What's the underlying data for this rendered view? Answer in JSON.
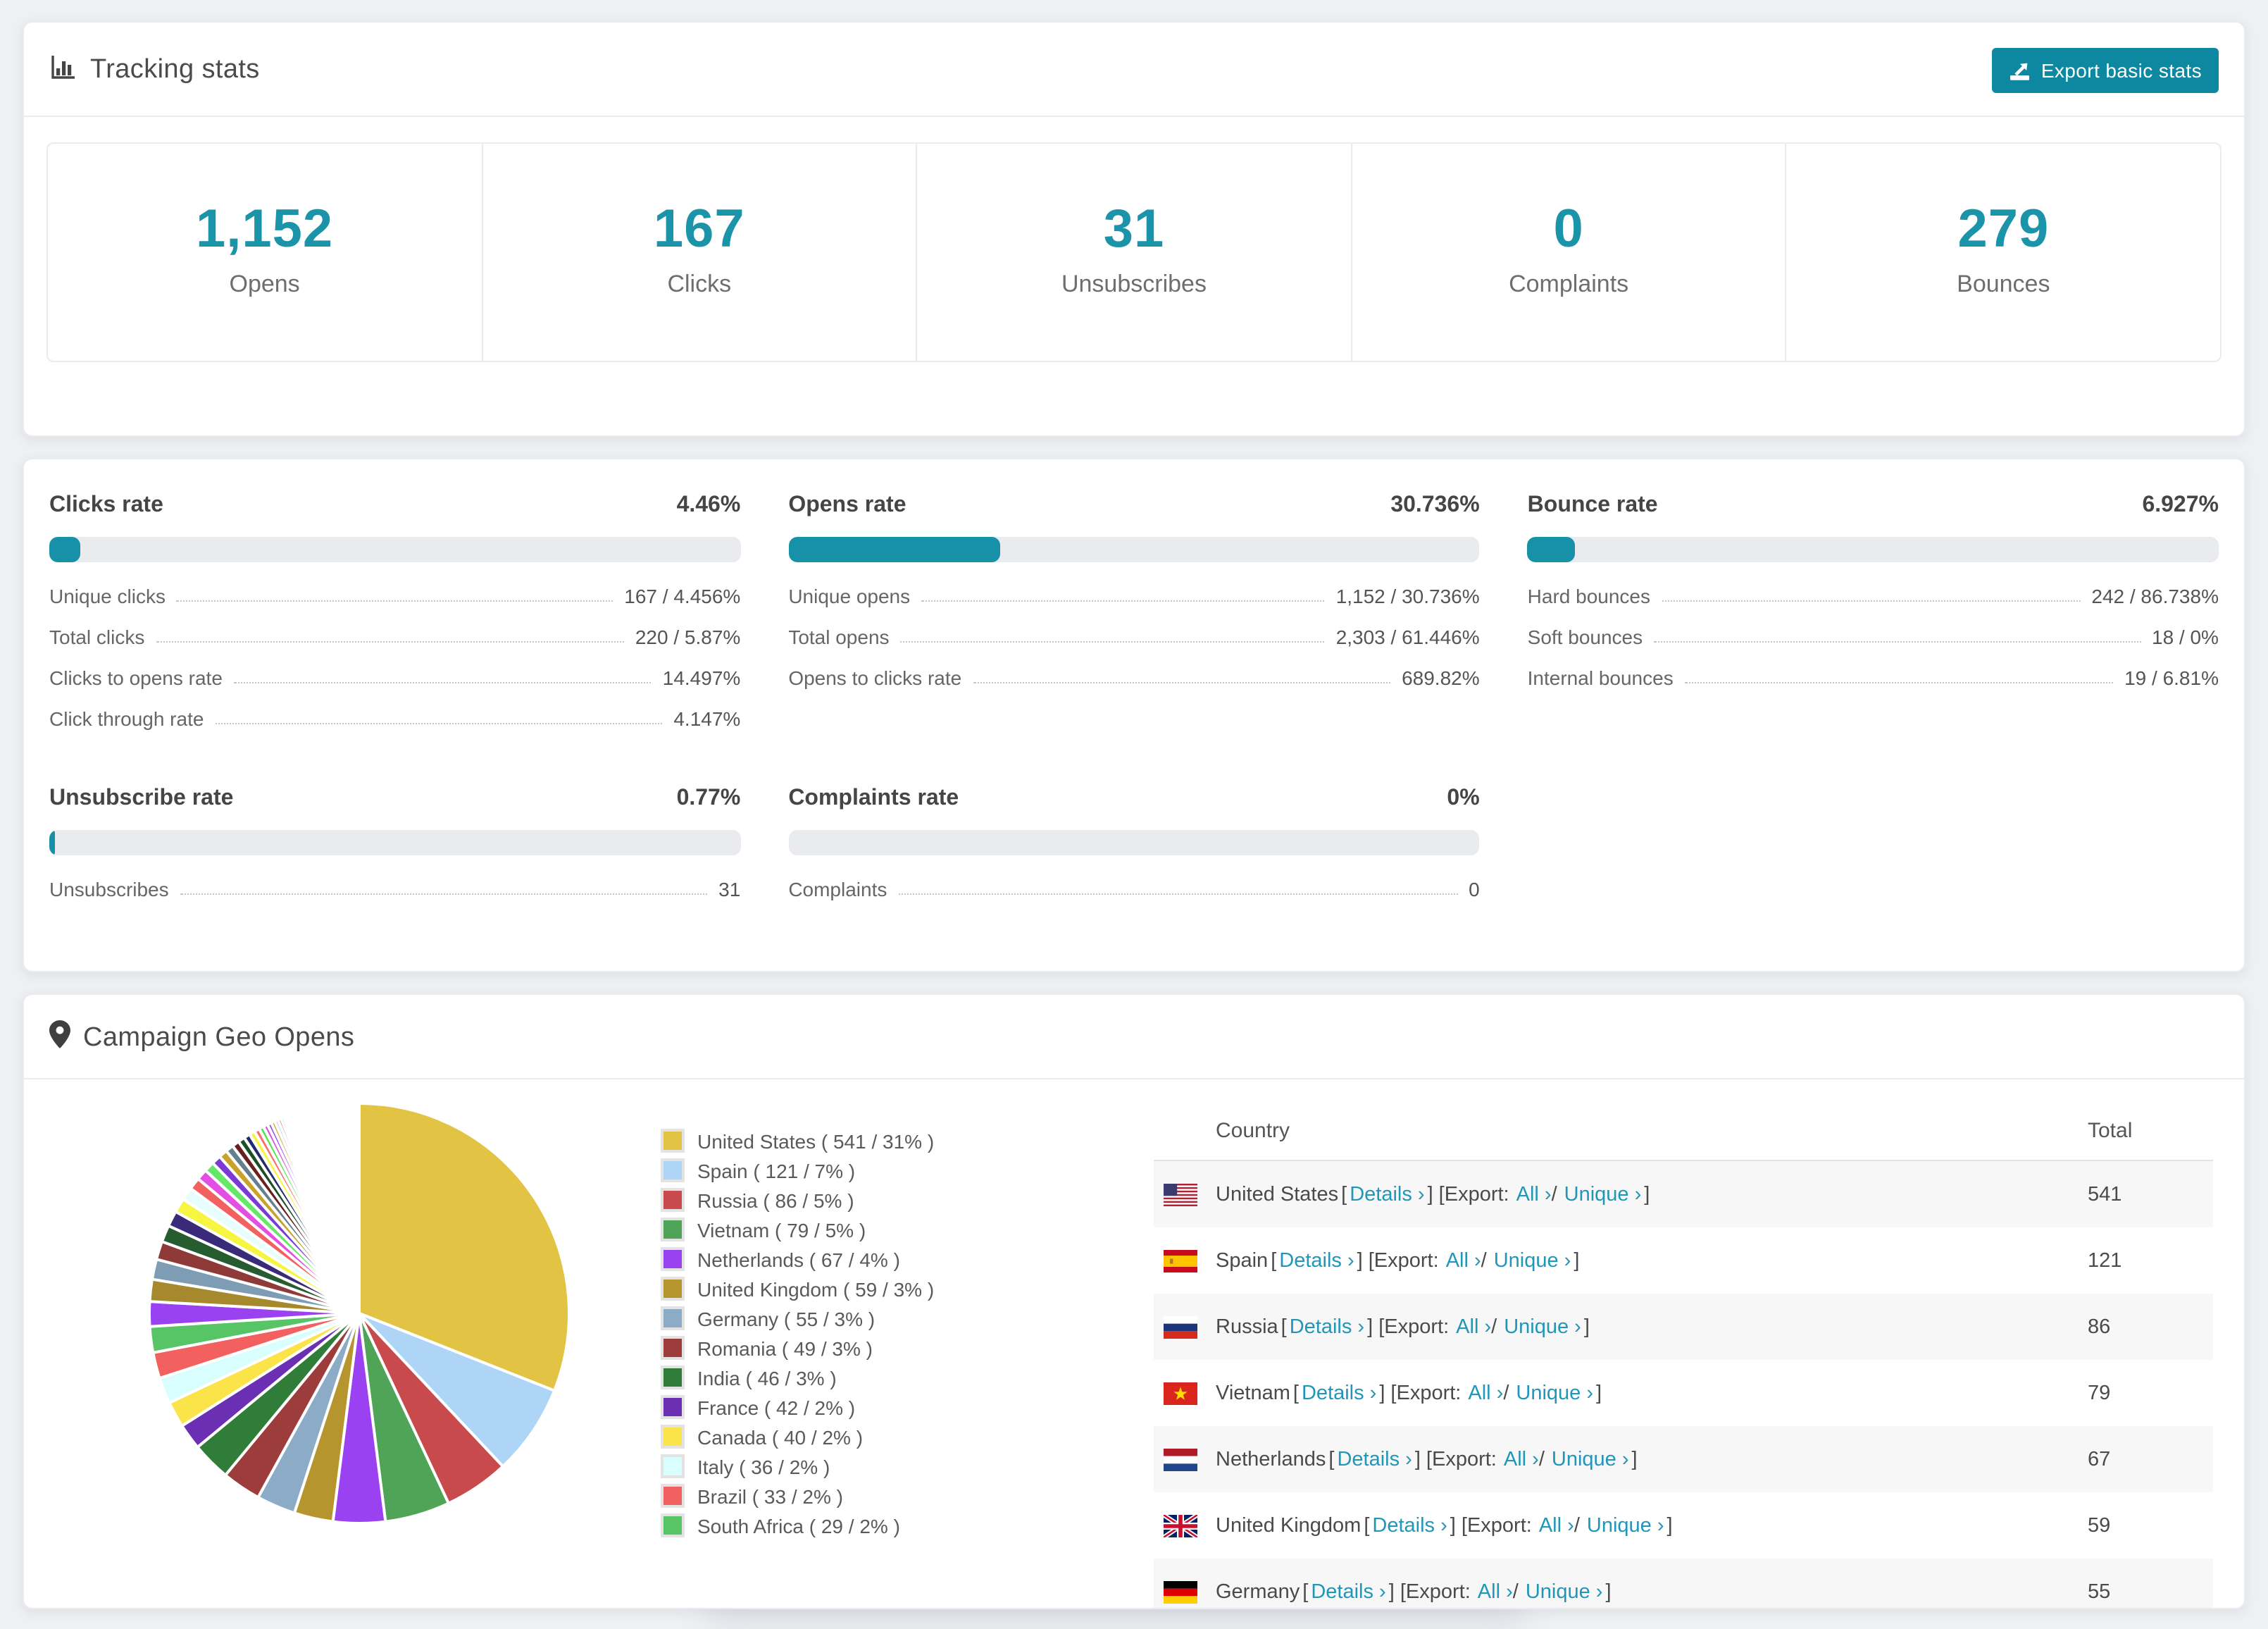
{
  "colors": {
    "accent_number": "#1b93a9",
    "accent_button": "#0e87a1",
    "accent_bar": "#1691a8",
    "link": "#2097b8",
    "page_bg": "#eef0f3"
  },
  "header": {
    "title": "Tracking stats",
    "export_button": "Export basic stats"
  },
  "stats": [
    {
      "value": "1,152",
      "label": "Opens"
    },
    {
      "value": "167",
      "label": "Clicks"
    },
    {
      "value": "31",
      "label": "Unsubscribes"
    },
    {
      "value": "0",
      "label": "Complaints"
    },
    {
      "value": "279",
      "label": "Bounces"
    }
  ],
  "rates": {
    "clicks": {
      "title": "Clicks rate",
      "value": "4.46%",
      "fill": 4.46,
      "rows": [
        {
          "label": "Unique clicks",
          "value": "167 / 4.456%"
        },
        {
          "label": "Total clicks",
          "value": "220 / 5.87%"
        },
        {
          "label": "Clicks to opens rate",
          "value": "14.497%"
        },
        {
          "label": "Click through rate",
          "value": "4.147%"
        }
      ]
    },
    "opens": {
      "title": "Opens rate",
      "value": "30.736%",
      "fill": 30.736,
      "rows": [
        {
          "label": "Unique opens",
          "value": "1,152 / 30.736%"
        },
        {
          "label": "Total opens",
          "value": "2,303 / 61.446%"
        },
        {
          "label": "Opens to clicks rate",
          "value": "689.82%"
        }
      ]
    },
    "bounce": {
      "title": "Bounce rate",
      "value": "6.927%",
      "fill": 6.927,
      "rows": [
        {
          "label": "Hard bounces",
          "value": "242 / 86.738%"
        },
        {
          "label": "Soft bounces",
          "value": "18 / 0%"
        },
        {
          "label": "Internal bounces",
          "value": "19 / 6.81%"
        }
      ]
    },
    "unsubscribe": {
      "title": "Unsubscribe rate",
      "value": "0.77%",
      "fill": 0.77,
      "rows": [
        {
          "label": "Unsubscribes",
          "value": "31"
        }
      ]
    },
    "complaints": {
      "title": "Complaints rate",
      "value": "0%",
      "fill": 0,
      "rows": [
        {
          "label": "Complaints",
          "value": "0"
        }
      ]
    }
  },
  "geo": {
    "title": "Campaign Geo Opens",
    "legend": [
      "United States ( 541 / 31% )",
      "Spain ( 121 / 7% )",
      "Russia ( 86 / 5% )",
      "Vietnam ( 79 / 5% )",
      "Netherlands ( 67 / 4% )",
      "United Kingdom ( 59 / 3% )",
      "Germany ( 55 / 3% )",
      "Romania ( 49 / 3% )",
      "India ( 46 / 3% )",
      "France ( 42 / 2% )",
      "Canada ( 40 / 2% )",
      "Italy ( 36 / 2% )",
      "Brazil ( 33 / 2% )",
      "South Africa ( 29 / 2% )"
    ],
    "table": {
      "headers": [
        "Country",
        "Total"
      ],
      "open_bracket": "[",
      "link_details": "Details ›",
      "after_details": "] [Export:",
      "link_all": "All ›",
      "slash": "/",
      "link_unique": "Unique ›",
      "close_bracket": "]",
      "rows": [
        {
          "country": "United States",
          "total": "541"
        },
        {
          "country": "Spain",
          "total": "121"
        },
        {
          "country": "Russia",
          "total": "86"
        },
        {
          "country": "Vietnam",
          "total": "79"
        },
        {
          "country": "Netherlands",
          "total": "67"
        },
        {
          "country": "United Kingdom",
          "total": "59"
        },
        {
          "country": "Germany",
          "total": "55"
        }
      ]
    }
  },
  "chart_data": {
    "type": "pie",
    "title": "Campaign Geo Opens",
    "unit": "opens",
    "start": "top",
    "direction": "clockwise",
    "legend_position": "right",
    "slices": [
      {
        "label": "United States",
        "value": 541,
        "percent": 31,
        "color": "#e2c344"
      },
      {
        "label": "Spain",
        "value": 121,
        "percent": 7,
        "color": "#aed5f5"
      },
      {
        "label": "Russia",
        "value": 86,
        "percent": 5,
        "color": "#c94a4d"
      },
      {
        "label": "Vietnam",
        "value": 79,
        "percent": 5,
        "color": "#50a457"
      },
      {
        "label": "Netherlands",
        "value": 67,
        "percent": 4,
        "color": "#9a41f2"
      },
      {
        "label": "United Kingdom",
        "value": 59,
        "percent": 3,
        "color": "#b6952f"
      },
      {
        "label": "Germany",
        "value": 55,
        "percent": 3,
        "color": "#8cabc6"
      },
      {
        "label": "Romania",
        "value": 49,
        "percent": 3,
        "color": "#9c3d3b"
      },
      {
        "label": "India",
        "value": 46,
        "percent": 3,
        "color": "#2f7d38"
      },
      {
        "label": "France",
        "value": 42,
        "percent": 2,
        "color": "#6b2fb3"
      },
      {
        "label": "Canada",
        "value": 40,
        "percent": 2,
        "color": "#fbe44a"
      },
      {
        "label": "Italy",
        "value": 36,
        "percent": 2,
        "color": "#d9fefe"
      },
      {
        "label": "Brazil",
        "value": 33,
        "percent": 2,
        "color": "#f2615f"
      },
      {
        "label": "South Africa",
        "value": 29,
        "percent": 2,
        "color": "#57c465"
      }
    ],
    "other_slices_percent": [
      1.9,
      1.7,
      1.55,
      1.4,
      1.3,
      1.2,
      1.1,
      1.0,
      0.92,
      0.85,
      0.78,
      0.72,
      0.66,
      0.61,
      0.56,
      0.52,
      0.48,
      0.44,
      0.4,
      0.37,
      0.34,
      0.31,
      0.29,
      0.27,
      0.25,
      0.23,
      0.21,
      0.19,
      0.18,
      0.16,
      0.15,
      0.14,
      0.13,
      0.12,
      0.11,
      0.1,
      0.09,
      0.08,
      0.07,
      0.06,
      0.05
    ],
    "other_colors_cycle": [
      "#9a41f2",
      "#a6892c",
      "#7f9cb5",
      "#8e3a38",
      "#275c31",
      "#3a2a7a",
      "#f5f542",
      "#e8fdfd",
      "#f2615f",
      "#e24fe2",
      "#63e868",
      "#7a3bd4",
      "#c9a227",
      "#64808f",
      "#6b2020",
      "#1d4f26",
      "#232b6e",
      "#f5f542",
      "#ff6b6b",
      "#4fe84f",
      "#d94fd9",
      "#9a41f2",
      "#c9a227",
      "#aed5f5",
      "#e04545",
      "#3fae4c"
    ]
  }
}
